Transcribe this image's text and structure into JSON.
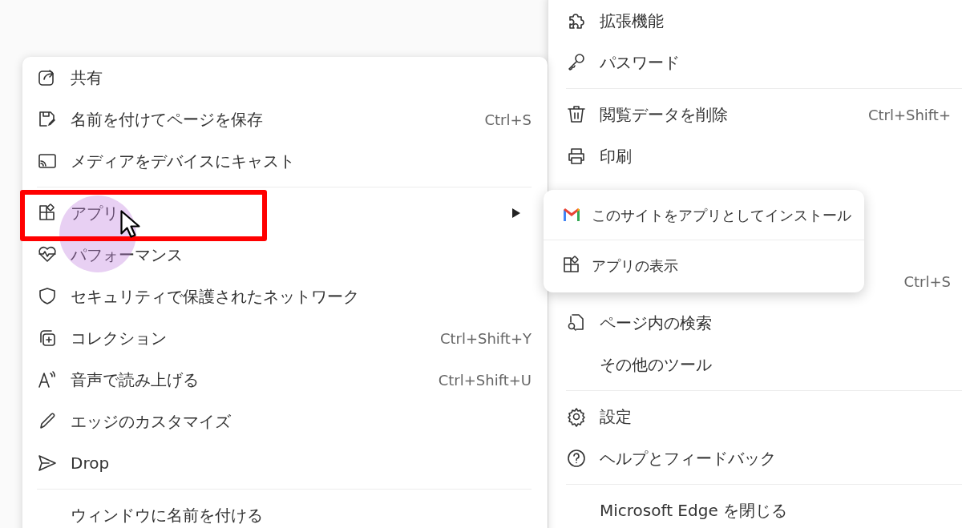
{
  "right_menu": {
    "items": [
      {
        "kind": "item",
        "label": "拡張機能"
      },
      {
        "kind": "item",
        "label": "パスワード"
      },
      {
        "kind": "divider"
      },
      {
        "kind": "item",
        "label": "閲覧データを削除",
        "shortcut": "Ctrl+Shift+"
      },
      {
        "kind": "item",
        "label": "印刷"
      },
      {
        "kind": "covered"
      },
      {
        "kind": "covered"
      },
      {
        "kind": "covered",
        "shortcut": "Ctrl+S"
      },
      {
        "kind": "item",
        "label": "ページ内の検索"
      },
      {
        "kind": "item",
        "label": "その他のツール"
      },
      {
        "kind": "divider"
      },
      {
        "kind": "item",
        "label": "設定"
      },
      {
        "kind": "item",
        "label": "ヘルプとフィードバック"
      },
      {
        "kind": "divider"
      },
      {
        "kind": "item",
        "label": "Microsoft Edge を閉じる"
      }
    ]
  },
  "left_menu": {
    "items": [
      {
        "kind": "item",
        "label": "共有"
      },
      {
        "kind": "item",
        "label": "名前を付けてページを保存",
        "shortcut": "Ctrl+S"
      },
      {
        "kind": "item",
        "label": "メディアをデバイスにキャスト"
      },
      {
        "kind": "divider"
      },
      {
        "kind": "submenu",
        "label": "アプリ"
      },
      {
        "kind": "item",
        "label": "パフォーマンス"
      },
      {
        "kind": "item",
        "label": "セキュリティで保護されたネットワーク"
      },
      {
        "kind": "item",
        "label": "コレクション",
        "shortcut": "Ctrl+Shift+Y"
      },
      {
        "kind": "item",
        "label": "音声で読み上げる",
        "shortcut": "Ctrl+Shift+U"
      },
      {
        "kind": "item",
        "label": "エッジのカスタマイズ"
      },
      {
        "kind": "item",
        "label": "Drop"
      },
      {
        "kind": "divider"
      },
      {
        "kind": "item",
        "label": "ウィンドウに名前を付ける"
      }
    ]
  },
  "submenu": {
    "items": [
      {
        "kind": "item",
        "label": "このサイトをアプリとしてインストール"
      },
      {
        "kind": "divider"
      },
      {
        "kind": "item",
        "label": "アプリの表示"
      }
    ]
  }
}
